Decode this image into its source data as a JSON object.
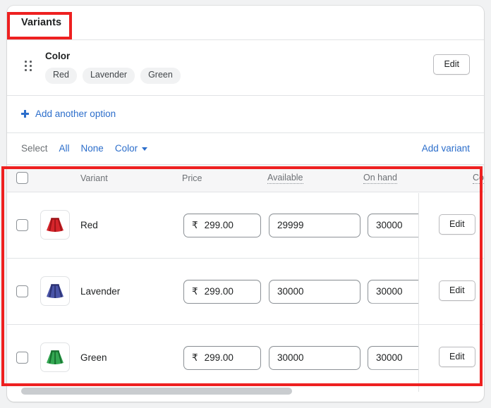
{
  "card": {
    "title": "Variants"
  },
  "option": {
    "drag_handle_icon": "drag-dots-icon",
    "name": "Color",
    "values": [
      "Red",
      "Lavender",
      "Green"
    ],
    "edit_label": "Edit"
  },
  "add_option": {
    "icon": "plus-icon",
    "label": "Add another option"
  },
  "toolbar": {
    "select_label": "Select",
    "all_label": "All",
    "none_label": "None",
    "color_label": "Color",
    "caret_icon": "chevron-down-icon",
    "add_variant_label": "Add variant"
  },
  "table": {
    "headers": {
      "variant": "Variant",
      "price": "Price",
      "available": "Available",
      "on_hand": "On hand",
      "cut_off": "Co"
    },
    "rows": [
      {
        "name": "Red",
        "thumb_icon": "skirt-thumbnail-red",
        "thumb_color": "#d5252b",
        "thumb_shade": "#9e1418",
        "currency": "₹",
        "price": "299.00",
        "available": "29999",
        "on_hand": "30000",
        "edit_label": "Edit"
      },
      {
        "name": "Lavender",
        "thumb_icon": "skirt-thumbnail-lavender",
        "thumb_color": "#4a55a8",
        "thumb_shade": "#2c3272",
        "currency": "₹",
        "price": "299.00",
        "available": "30000",
        "on_hand": "30000",
        "edit_label": "Edit"
      },
      {
        "name": "Green",
        "thumb_icon": "skirt-thumbnail-green",
        "thumb_color": "#34a853",
        "thumb_shade": "#17702f",
        "currency": "₹",
        "price": "299.00",
        "available": "30000",
        "on_hand": "30000",
        "edit_label": "Edit"
      }
    ]
  },
  "colors": {
    "link": "#2c6ecb",
    "annotation": "#ee2020",
    "header_bg": "#f6f6f7",
    "border": "#e1e3e5"
  }
}
